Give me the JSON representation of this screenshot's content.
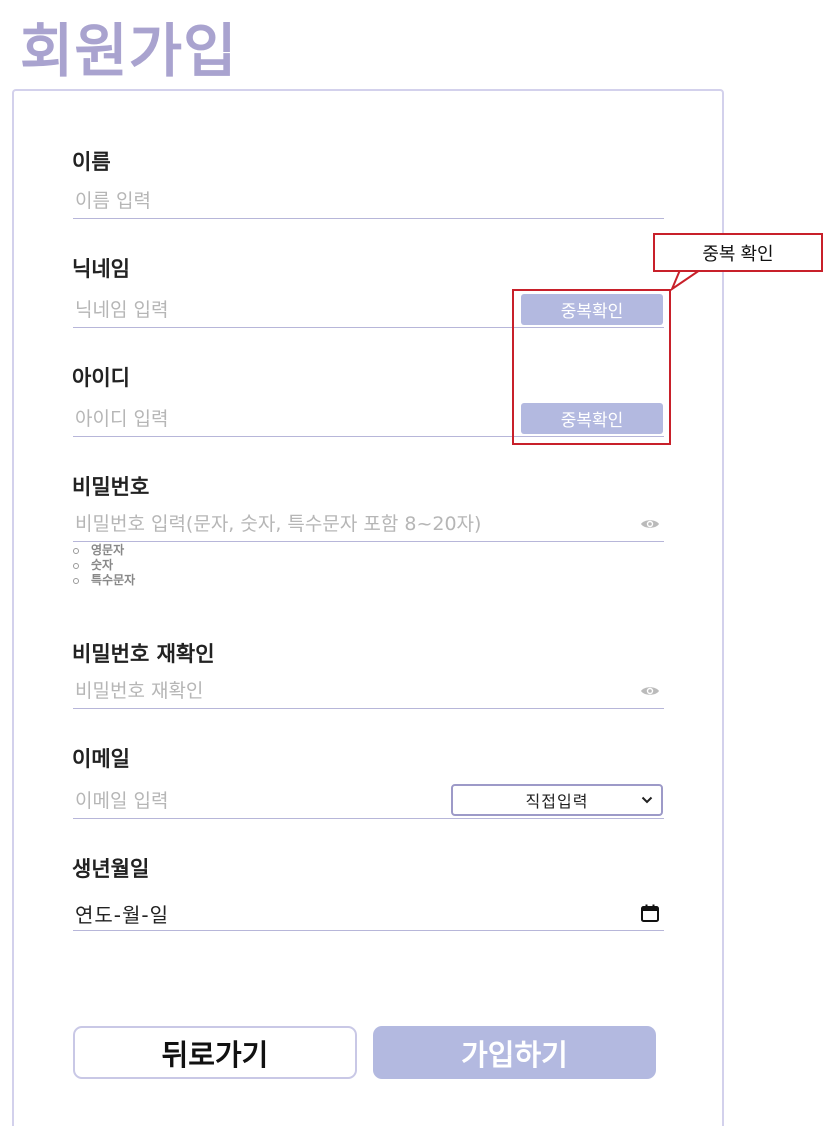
{
  "page": {
    "title": "회원가입"
  },
  "fields": {
    "name": {
      "label": "이름",
      "placeholder": "이름 입력"
    },
    "nickname": {
      "label": "닉네임",
      "placeholder": "닉네임 입력",
      "check_label": "중복확인"
    },
    "userid": {
      "label": "아이디",
      "placeholder": "아이디 입력",
      "check_label": "중복확인"
    },
    "password": {
      "label": "비밀번호",
      "placeholder": "비밀번호 입력(문자, 숫자, 특수문자 포함 8~20자)",
      "rules": [
        "영문자",
        "숫자",
        "특수문자"
      ]
    },
    "password_confirm": {
      "label": "비밀번호 재확인",
      "placeholder": "비밀번호 재확인"
    },
    "email": {
      "label": "이메일",
      "placeholder": "이메일 입력",
      "domain_selected": "직접입력"
    },
    "birthdate": {
      "label": "생년월일",
      "value": "연도-월-일"
    }
  },
  "buttons": {
    "back": "뒤로가기",
    "join": "가입하기"
  },
  "annotation": {
    "callout_text": "중복 확인"
  },
  "icons": {
    "eye": "eye-icon",
    "calendar": "calendar-icon",
    "chevron": "chevron-down-icon"
  },
  "colors": {
    "title": "#a9a3cf",
    "accent": "#b3b9e0",
    "border": "#d3d1ec",
    "annotation": "#c8202a"
  }
}
